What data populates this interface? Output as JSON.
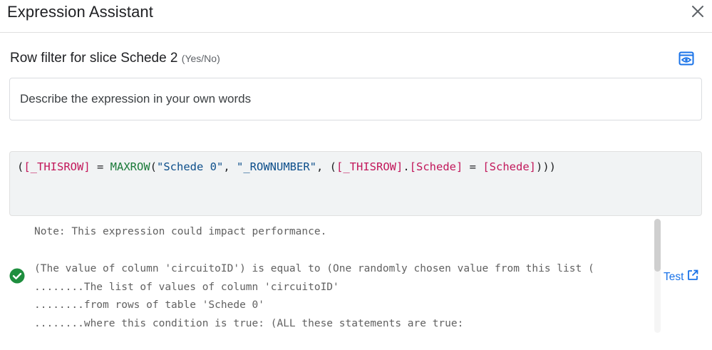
{
  "dialog": {
    "title": "Expression Assistant",
    "close_icon": "close-icon"
  },
  "field": {
    "label": "Row filter for slice Schede 2",
    "type": "(Yes/No)",
    "preview_icon": "eye-icon"
  },
  "describe": {
    "placeholder": "Describe the expression in your own words",
    "value": ""
  },
  "expression": {
    "tokens": [
      {
        "text": "(",
        "kind": "plain"
      },
      {
        "text": "[_THISROW]",
        "kind": "ref"
      },
      {
        "text": " = ",
        "kind": "plain"
      },
      {
        "text": "MAXROW",
        "kind": "fn"
      },
      {
        "text": "(",
        "kind": "plain"
      },
      {
        "text": "\"Schede 0\"",
        "kind": "str"
      },
      {
        "text": ", ",
        "kind": "plain"
      },
      {
        "text": "\"_ROWNUMBER\"",
        "kind": "str"
      },
      {
        "text": ", (",
        "kind": "plain"
      },
      {
        "text": "[_THISROW]",
        "kind": "ref"
      },
      {
        "text": ".",
        "kind": "plain"
      },
      {
        "text": "[Schede]",
        "kind": "ref"
      },
      {
        "text": " = ",
        "kind": "plain"
      },
      {
        "text": "[Schede]",
        "kind": "ref"
      },
      {
        "text": ")))",
        "kind": "plain"
      }
    ]
  },
  "output": {
    "note": "Note: This expression could impact performance.",
    "status_icon": "check-circle-icon",
    "lines": [
      "(The value of column 'circuitoID') is equal to (One randomly chosen value from this list (",
      "........The list of values of column 'circuitoID'",
      "........from rows of table 'Schede 0'",
      "........where this condition is true: (ALL these statements are true:"
    ]
  },
  "test": {
    "label": "Test",
    "icon": "open-in-new-icon"
  },
  "colors": {
    "accent": "#1a73e8",
    "success": "#1e8e3e",
    "ref": "#c2185b",
    "function": "#1b7a3a",
    "string": "#0d4f8b"
  }
}
